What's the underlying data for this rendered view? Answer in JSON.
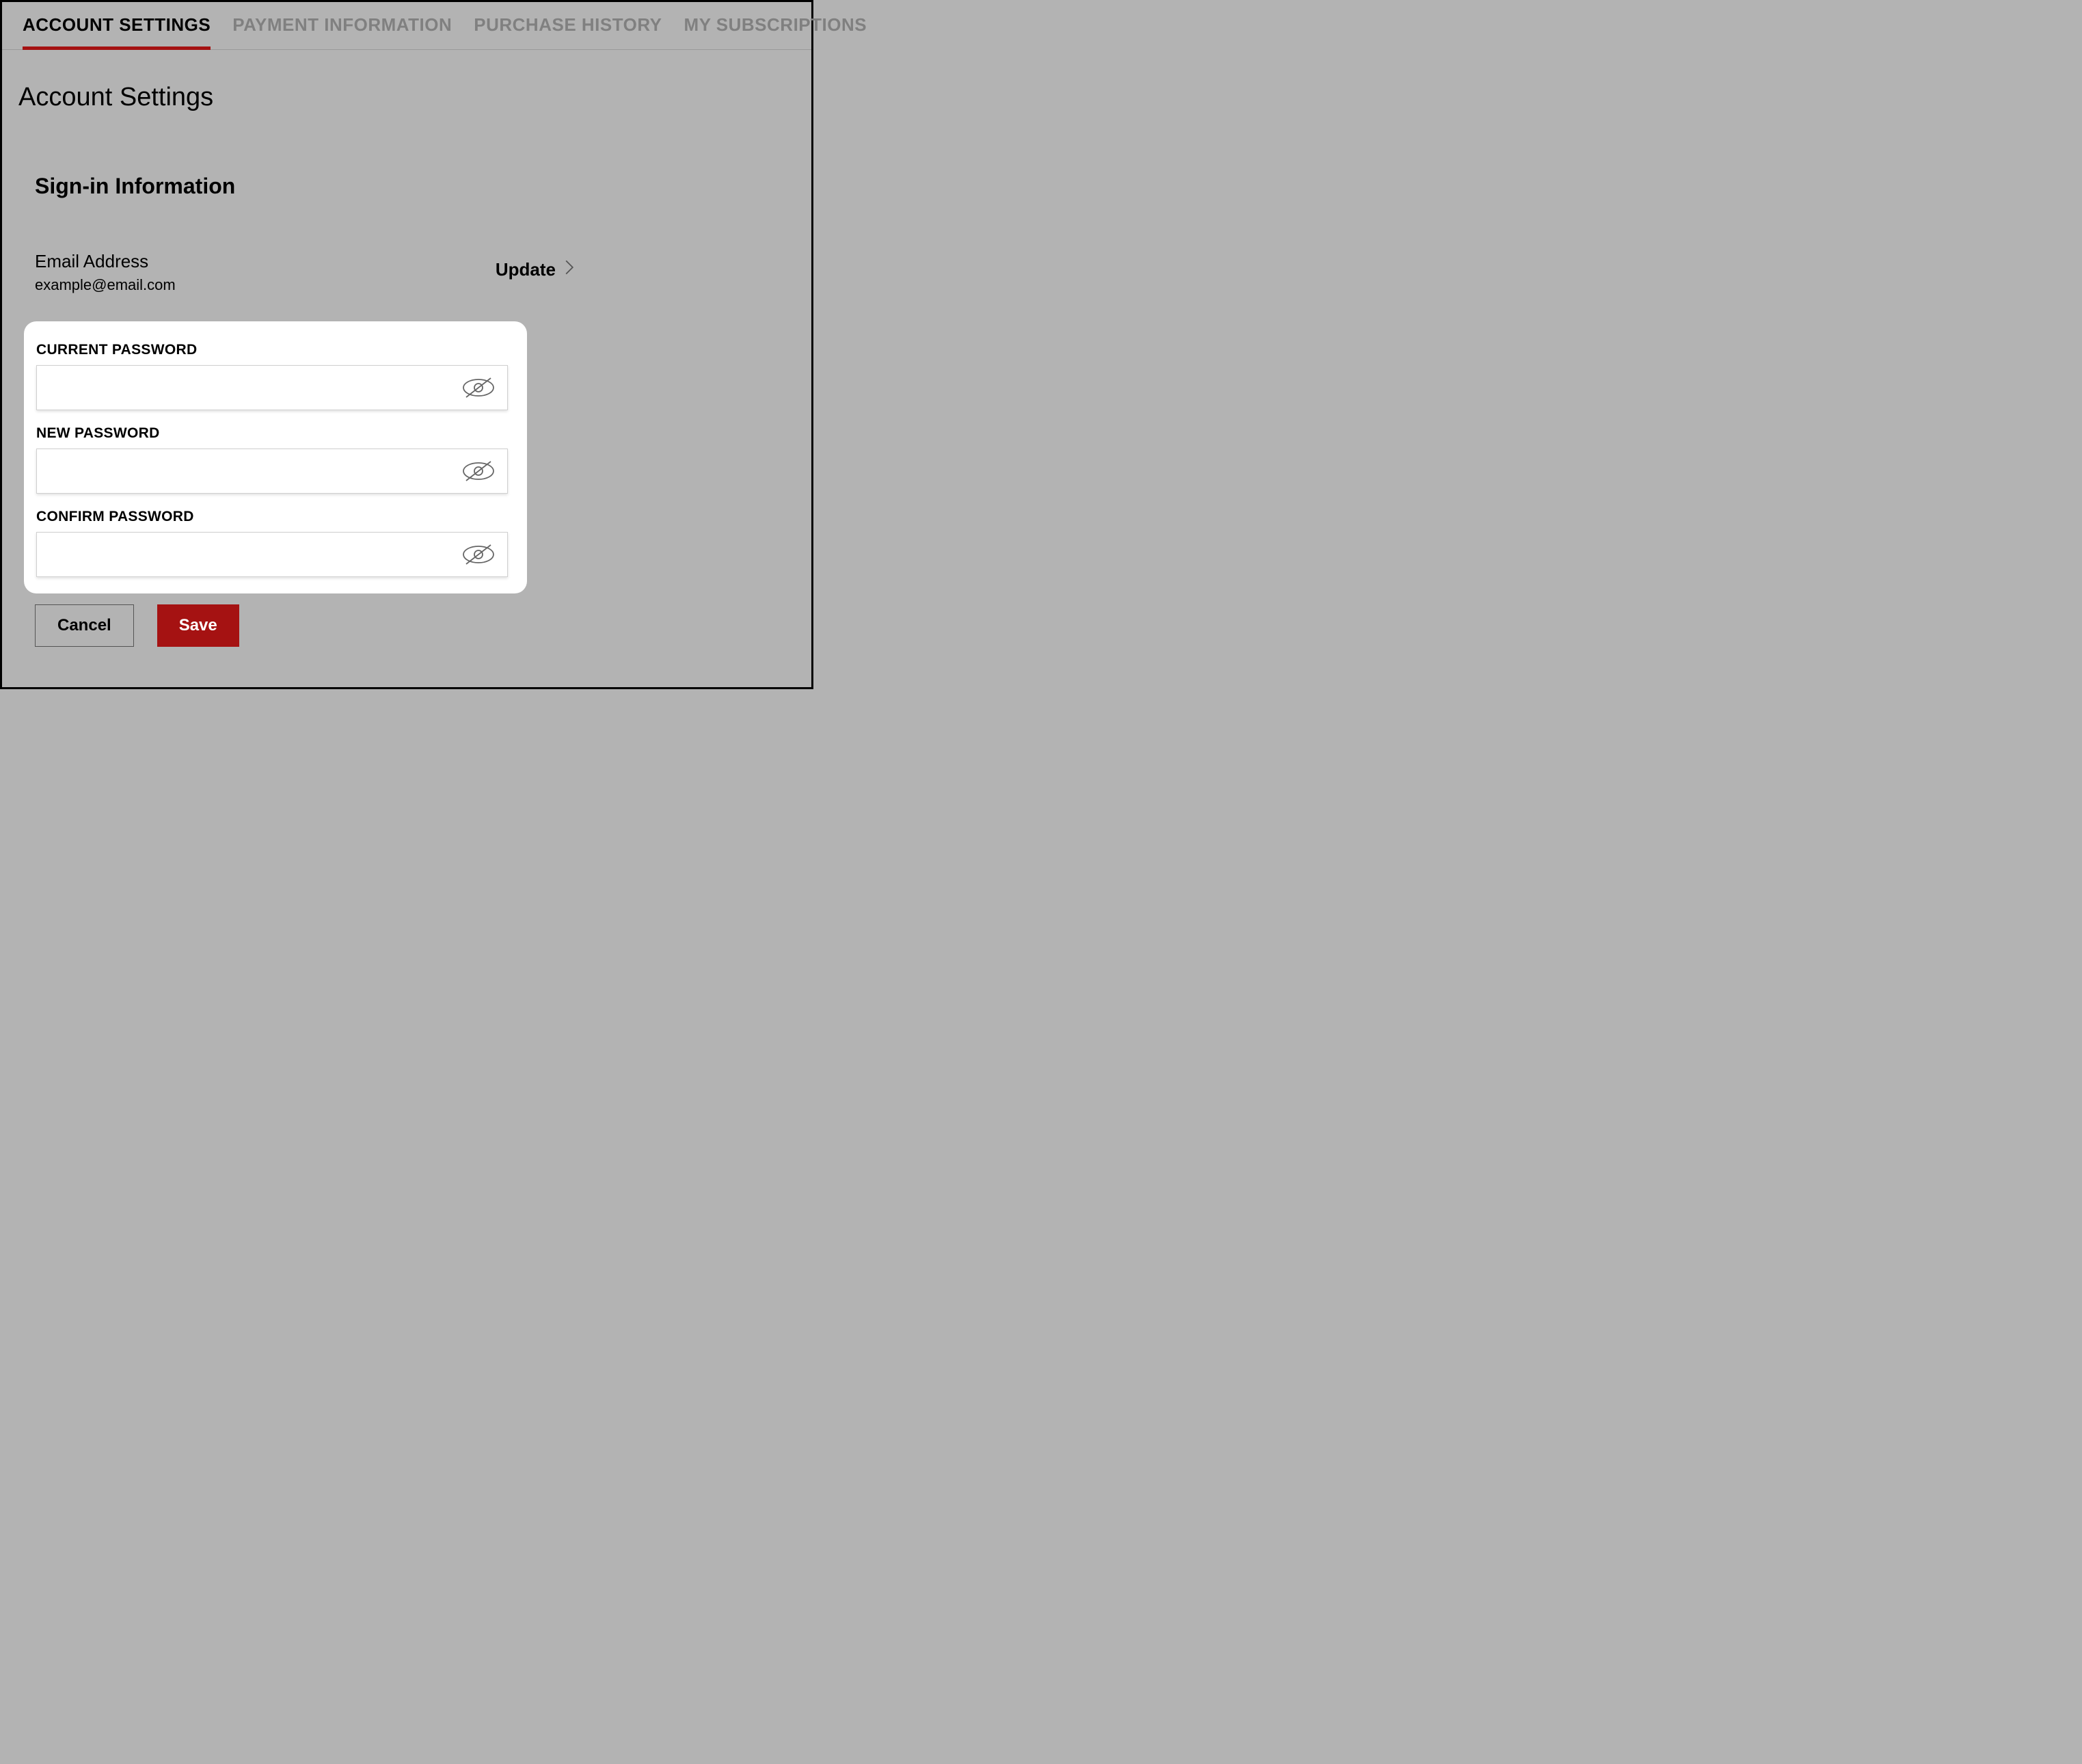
{
  "tabs": [
    {
      "label": "ACCOUNT SETTINGS",
      "active": true
    },
    {
      "label": "PAYMENT INFORMATION",
      "active": false
    },
    {
      "label": "PURCHASE HISTORY",
      "active": false
    },
    {
      "label": "MY SUBSCRIPTIONS",
      "active": false
    }
  ],
  "page_title": "Account Settings",
  "section_title": "Sign-in Information",
  "email": {
    "label": "Email Address",
    "value": "example@email.com",
    "update_label": "Update"
  },
  "password_form": {
    "current_label": "CURRENT PASSWORD",
    "current_value": "",
    "new_label": "NEW PASSWORD",
    "new_value": "",
    "confirm_label": "CONFIRM PASSWORD",
    "confirm_value": ""
  },
  "buttons": {
    "cancel": "Cancel",
    "save": "Save"
  }
}
